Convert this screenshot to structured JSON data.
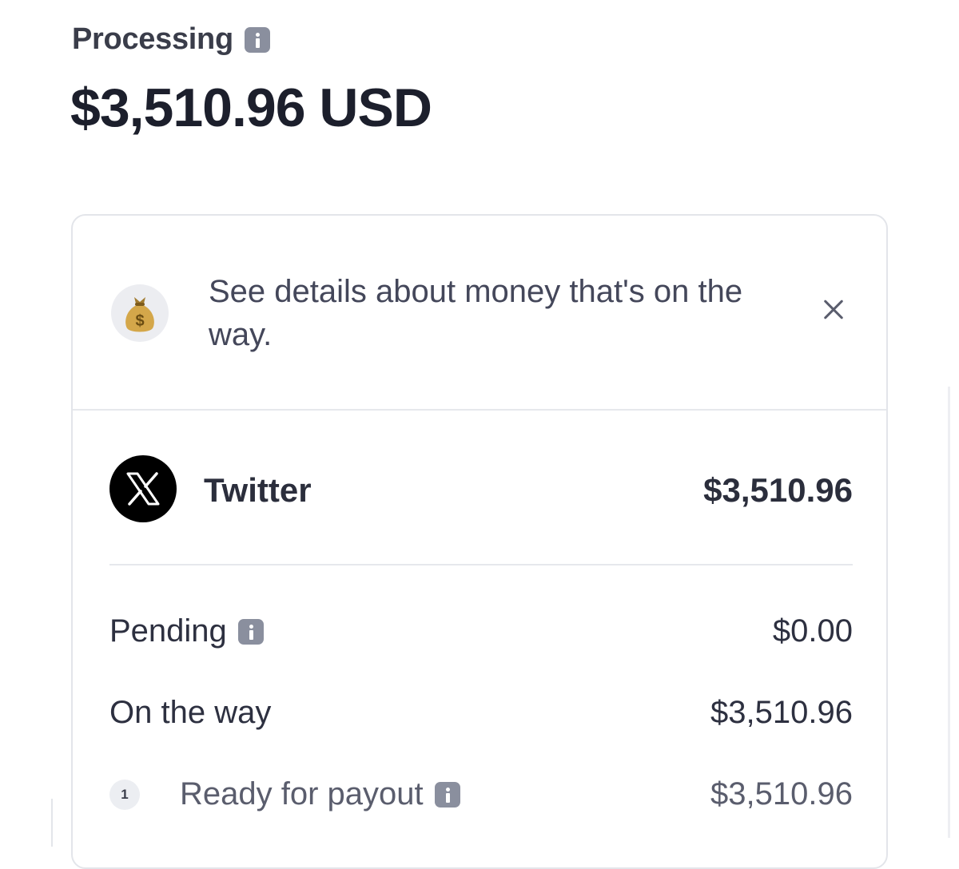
{
  "header": {
    "label": "Processing",
    "amount": "$3,510.96 USD"
  },
  "banner": {
    "text": "See details about money that's on the way."
  },
  "source": {
    "name": "Twitter",
    "amount": "$3,510.96"
  },
  "breakdown": {
    "pending_label": "Pending",
    "pending_value": "$0.00",
    "on_the_way_label": "On the way",
    "on_the_way_value": "$3,510.96",
    "step_number": "1",
    "ready_label": "Ready for payout",
    "ready_value": "$3,510.96"
  },
  "icons": {
    "info": "info-icon",
    "money_bag": "money-bag-icon",
    "close": "close-icon",
    "x_logo": "x-logo-icon"
  },
  "colors": {
    "text_primary": "#1c1f2c",
    "text_secondary": "#5a5d6d",
    "info_icon": "#8a8f9e",
    "card_border": "#e3e5ea",
    "x_logo_bg": "#000000"
  }
}
